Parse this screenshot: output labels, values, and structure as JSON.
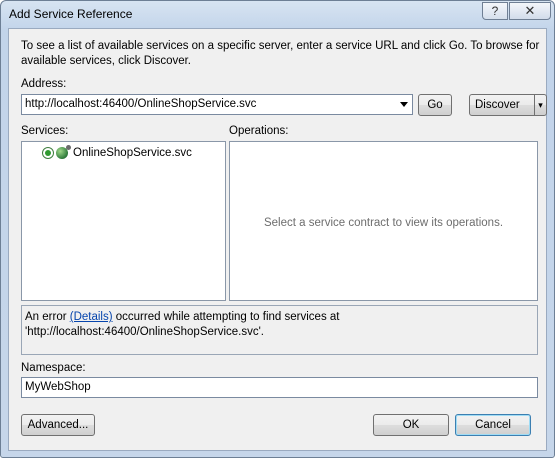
{
  "window": {
    "title": "Add Service Reference",
    "help_glyph": "?",
    "close_glyph": "✕"
  },
  "intro": "To see a list of available services on a specific server, enter a service URL and click Go. To browse for available services, click Discover.",
  "address": {
    "label": "Address:",
    "value": "http://localhost:46400/OnlineShopService.svc",
    "dropdown_icon": "chevron-down-icon"
  },
  "buttons": {
    "go": "Go",
    "discover": "Discover",
    "discover_arrow": "▾",
    "advanced": "Advanced...",
    "ok": "OK",
    "cancel": "Cancel"
  },
  "services": {
    "label": "Services:",
    "items": [
      {
        "label": "OnlineShopService.svc",
        "icon": "web-service-icon"
      }
    ]
  },
  "operations": {
    "label": "Operations:",
    "empty_message": "Select a service contract to view its operations."
  },
  "status": {
    "prefix": "An error ",
    "link": "(Details)",
    "suffix_line1": " occurred while attempting to find services at",
    "line2": "'http://localhost:46400/OnlineShopService.svc'."
  },
  "namespace": {
    "label": "Namespace:",
    "value": "MyWebShop"
  }
}
